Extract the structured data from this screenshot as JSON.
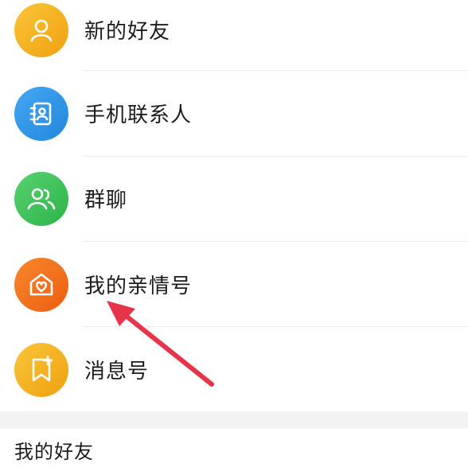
{
  "contacts_menu": {
    "items": [
      {
        "label": "新的好友",
        "icon": "person-icon",
        "color": "#F5B21B"
      },
      {
        "label": "手机联系人",
        "icon": "address-book-icon",
        "color": "#2F95E8"
      },
      {
        "label": "群聊",
        "icon": "group-icon",
        "color": "#3FC25A"
      },
      {
        "label": "我的亲情号",
        "icon": "family-heart-icon",
        "color": "#F2711C"
      },
      {
        "label": "消息号",
        "icon": "message-bookmark-icon",
        "color": "#F5B21B"
      }
    ]
  },
  "friends_section": {
    "title": "我的好友"
  },
  "annotation": {
    "arrow_color": "#E8344B"
  }
}
